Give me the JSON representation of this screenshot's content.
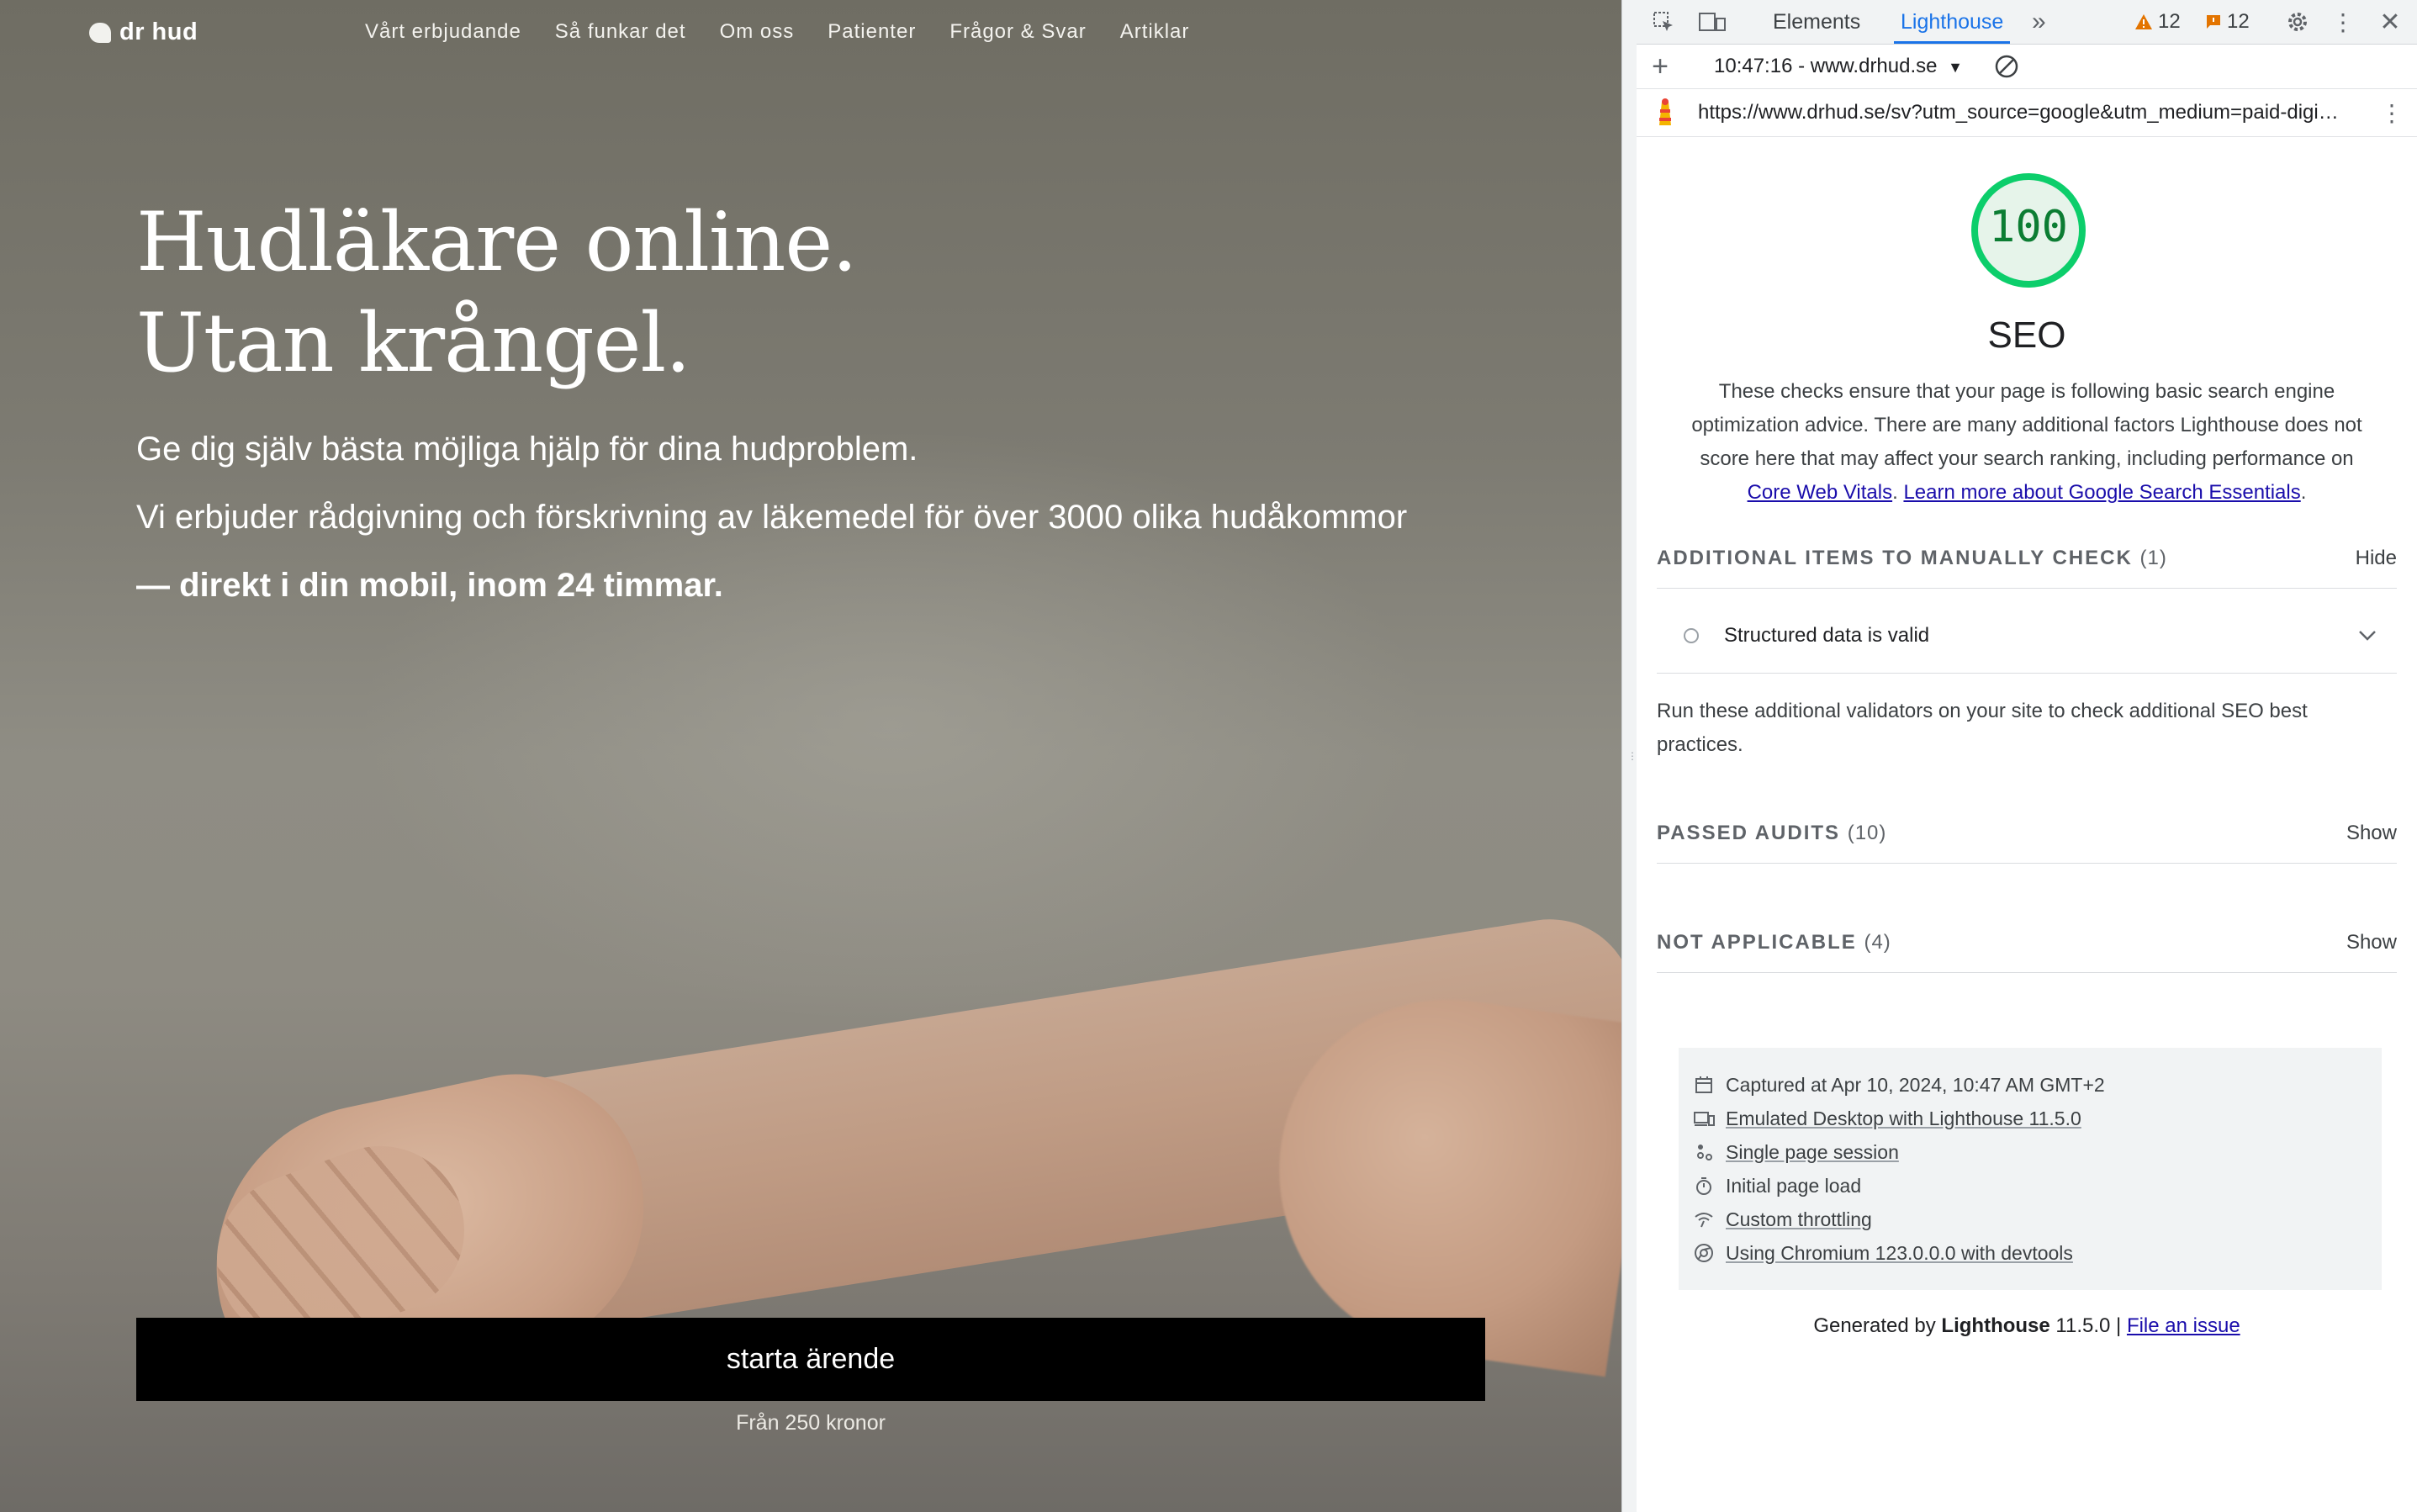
{
  "site": {
    "logo_text": "dr hud",
    "nav": [
      "Vårt erbjudande",
      "Så funkar det",
      "Om oss",
      "Patienter",
      "Frågor & Svar",
      "Artiklar"
    ],
    "hero_title_line1": "Hudläkare online.",
    "hero_title_line2": "Utan krångel.",
    "subtitle1": "Ge dig själv bästa möjliga hjälp för dina hudproblem.",
    "subtitle2": "Vi erbjuder rådgivning och förskrivning av läkemedel för över 3000 olika hudåkommor",
    "subtitle3": "— direkt i din mobil, inom 24 timmar.",
    "cta_label": "starta ärende",
    "price_note": "Från 250 kronor"
  },
  "devtools": {
    "tabs": [
      "Elements",
      "Lighthouse"
    ],
    "active_tab": "Lighthouse",
    "more_tabs_glyph": "»",
    "warnings_count": "12",
    "issues_count": "12",
    "report_selector": "10:47:16 - www.drhud.se",
    "url": "https://www.drhud.se/sv?utm_source=google&utm_medium=paid-digi…",
    "score": "100",
    "score_fraction": 1.0,
    "category_title": "SEO",
    "description_prefix": "These checks ensure that your page is following basic search engine optimization advice. There are many additional factors Lighthouse does not score here that may affect your search ranking, including performance on ",
    "link_core_web_vitals": "Core Web Vitals",
    "description_mid": ". ",
    "link_learn_more": "Learn more about Google Search Essentials",
    "description_suffix": ".",
    "manual_group": {
      "label": "ADDITIONAL ITEMS TO MANUALLY CHECK",
      "count": "(1)",
      "toggle": "Hide",
      "items": [
        "Structured data is valid"
      ],
      "description": "Run these additional validators on your site to check additional SEO best practices."
    },
    "passed_group": {
      "label": "PASSED AUDITS",
      "count": "(10)",
      "toggle": "Show"
    },
    "na_group": {
      "label": "NOT APPLICABLE",
      "count": "(4)",
      "toggle": "Show"
    },
    "environment": [
      {
        "icon": "calendar-icon",
        "text": "Captured at Apr 10, 2024, 10:47 AM GMT+2",
        "underline": false
      },
      {
        "icon": "devices-icon",
        "text": "Emulated Desktop with Lighthouse 11.5.0",
        "underline": true
      },
      {
        "icon": "session-icon",
        "text": "Single page session",
        "underline": true
      },
      {
        "icon": "stopwatch-icon",
        "text": "Initial page load",
        "underline": false
      },
      {
        "icon": "network-icon",
        "text": "Custom throttling",
        "underline": true
      },
      {
        "icon": "chromium-icon",
        "text": "Using Chromium 123.0.0.0 with devtools",
        "underline": true
      }
    ],
    "footer_prefix": "Generated by ",
    "footer_brand": "Lighthouse",
    "footer_version": " 11.5.0 | ",
    "footer_link": "File an issue"
  },
  "colors": {
    "score_green": "#0c7d33",
    "gauge_ring": "#0cce6b",
    "gauge_fill": "#e6f4ea",
    "accent_blue": "#1a73e8",
    "warning_orange": "#e37400",
    "cta_black": "#000000"
  }
}
